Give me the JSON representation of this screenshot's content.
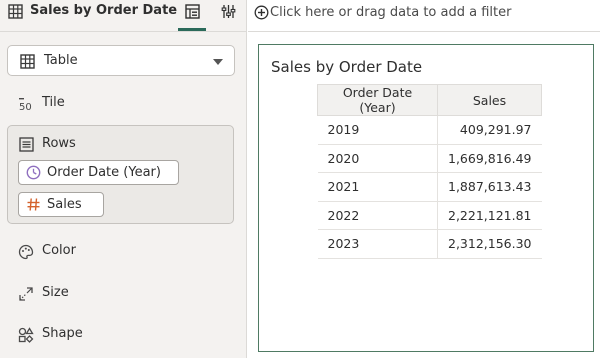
{
  "panel": {
    "title": "Sales by Order Date",
    "viz_type": "Table",
    "grammar": {
      "tile": "Tile",
      "rows": "Rows",
      "color": "Color",
      "size": "Size",
      "shape": "Shape"
    },
    "row_pills": [
      "Order Date (Year)",
      "Sales"
    ]
  },
  "filter_bar": {
    "text": "Click here or drag data to add a filter"
  },
  "canvas": {
    "title": "Sales by Order Date",
    "table": {
      "headers": [
        "Order Date (Year)",
        "Sales"
      ],
      "rows": [
        [
          "2019",
          "409,291.97"
        ],
        [
          "2020",
          "1,669,816.49"
        ],
        [
          "2021",
          "1,887,613.43"
        ],
        [
          "2022",
          "2,221,121.81"
        ],
        [
          "2023",
          "2,312,156.30"
        ]
      ]
    }
  },
  "icons": {
    "table": "table-icon",
    "grammar_tab": "grammar-icon",
    "properties_tab": "sliders-icon",
    "tile": "tile-icon",
    "rows": "rows-icon",
    "date": "clock-icon",
    "measure": "hash-icon",
    "color": "palette-icon",
    "size": "size-icon",
    "shape": "shape-icon",
    "add_filter": "plus-circle-icon"
  },
  "colors": {
    "accent": "#2b6a5a",
    "frame": "#4f7a63",
    "date_icon": "#8f6fbf",
    "measure_icon": "#d4622c"
  }
}
